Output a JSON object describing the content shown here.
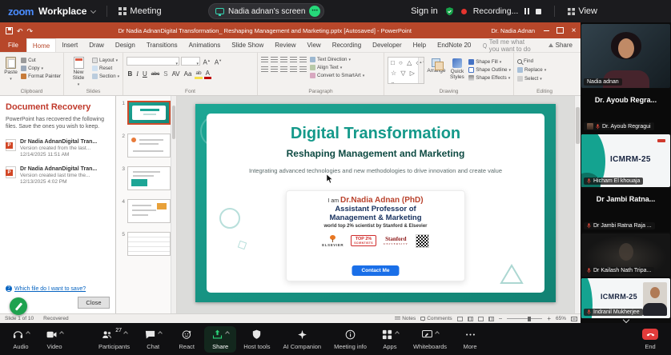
{
  "zoom_top": {
    "logo_zoom": "zoom",
    "logo_workplace": "Workplace",
    "meeting": "Meeting",
    "screen_share_pill": "Nadia adnan's screen",
    "sign_in": "Sign in",
    "recording": "Recording...",
    "view": "View"
  },
  "ppt": {
    "titlebar": {
      "title": "Dr Nadia AdnanDigital Transformation_ Reshaping Management and Marketing.pptx [Autosaved] - PowerPoint",
      "account": "Dr. Nadia Adnan",
      "close_glyph": "×"
    },
    "tabs": [
      "File",
      "Home",
      "Insert",
      "Draw",
      "Design",
      "Transitions",
      "Animations",
      "Slide Show",
      "Review",
      "View",
      "Recording",
      "Developer",
      "Help",
      "EndNote 20"
    ],
    "tell_me": "Tell me what you want to do",
    "share_button": "Share",
    "ribbon": {
      "paste": "Paste",
      "cut": "Cut",
      "copy": "Copy",
      "format_painter": "Format Painter",
      "clipboard_label": "Clipboard",
      "new_slide": "New Slide",
      "layout": "Layout",
      "reset": "Reset",
      "section": "Section",
      "slides_label": "Slides",
      "font_label": "Font",
      "font_glyphs": {
        "bold": "B",
        "italic": "I",
        "underline": "U",
        "strike": "abc",
        "shadow": "S",
        "spacing": "AV",
        "case": "Aa",
        "highlight": "ab",
        "color": "A"
      },
      "text_direction": "Text Direction",
      "align_text": "Align Text",
      "convert_smartart": "Convert to SmartArt",
      "paragraph_label": "Paragraph",
      "arrange": "Arrange",
      "quick_styles": "Quick Styles",
      "shape_fill": "Shape Fill",
      "shape_outline": "Shape Outline",
      "shape_effects": "Shape Effects",
      "drawing_label": "Drawing",
      "find": "Find",
      "replace": "Replace",
      "select": "Select",
      "editing_label": "Editing"
    },
    "recovery": {
      "title": "Document Recovery",
      "description": "PowerPoint has recovered the following files. Save the ones you wish to keep.",
      "files": [
        {
          "name": "Dr Nadia AdnanDigital Tran...",
          "version": "Version created from the last...",
          "date": "12/14/2025 11:51 AM"
        },
        {
          "name": "Dr Nadia AdnanDigital Tran...",
          "version": "Version created last time the...",
          "date": "12/13/2025 4:02 PM"
        }
      ],
      "help_link": "Which file do I want to save?",
      "help_glyph": "?",
      "close_button": "Close"
    },
    "thumbnails": [
      "1",
      "2",
      "3",
      "4",
      "5"
    ],
    "slide": {
      "title": "Digital Transformation",
      "subtitle": "Reshaping Management and Marketing",
      "body_line": "Integrating advanced technologies and new methodologies to drive innovation and create value",
      "card": {
        "intro": "I am",
        "name": "Dr.Nadia Adnan (PhD)",
        "role_line1": "Assistant Professor of",
        "role_line2": "Management & Marketing",
        "tagline": "world top 2% scientist by Stanford & Elsevier",
        "elsevier": "ELSEVIER",
        "badge_top": "TOP 2%",
        "badge_bottom": "SCIENTISTS",
        "stanford_line1": "Stanford",
        "stanford_line2": "UNIVERSITY",
        "cta": "Contact Me"
      }
    },
    "statusbar": {
      "slide_info": "Slide 1 of 10",
      "recovered": "Recovered",
      "notes": "Notes",
      "comments": "Comments",
      "zoom_level": "65%"
    }
  },
  "participants": {
    "tiles": [
      {
        "tag": "Nadia adnan"
      },
      {
        "display": "Dr. Ayoub Regra...",
        "tag": "Dr. Ayoub Regragui"
      },
      {
        "display": "ICMRM-25",
        "tag": "Hicham El khouaja"
      },
      {
        "display": "Dr Jambi Ratna...",
        "tag": "Dr Jambi Ratna Raja ..."
      },
      {
        "tag": "Dr Kailash Nath Tripa..."
      },
      {
        "display": "ICMRM-25",
        "tag": "Indranil Mukherjee"
      }
    ]
  },
  "zoom_bottom": {
    "buttons": [
      {
        "label": "Audio"
      },
      {
        "label": "Video"
      },
      {
        "label": "Participants",
        "badge": "27"
      },
      {
        "label": "Chat"
      },
      {
        "label": "React"
      },
      {
        "label": "Share"
      },
      {
        "label": "Host tools"
      },
      {
        "label": "AI Companion"
      },
      {
        "label": "Meeting info"
      },
      {
        "label": "Apps"
      },
      {
        "label": "Whiteboards"
      },
      {
        "label": "More"
      },
      {
        "label": "End"
      }
    ]
  },
  "colors": {
    "ppt_chrome": "#B7472A",
    "slide_teal": "#18998B",
    "share_green": "#26D97A",
    "record_red": "#E5342E",
    "cta_blue": "#1A6FE8"
  }
}
